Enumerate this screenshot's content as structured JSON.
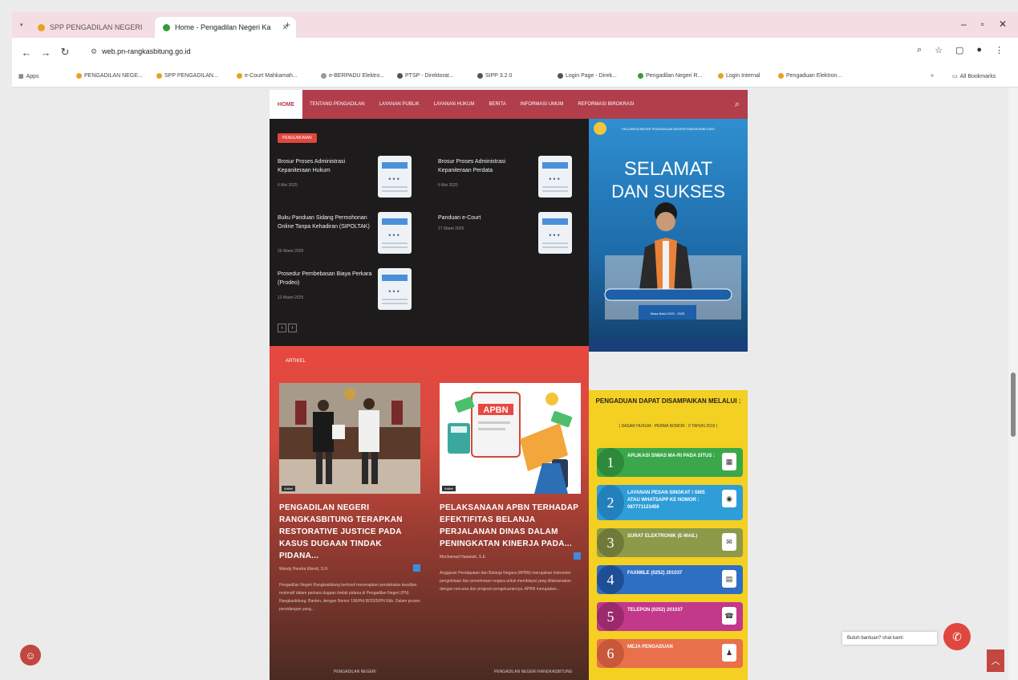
{
  "browser": {
    "tabs": [
      {
        "label": "SPP PENGADILAN NEGERI",
        "active": false
      },
      {
        "label": "Home - Pengadilan Negeri Ka",
        "active": true
      }
    ],
    "url": "web.pn-rangkasbitung.go.id",
    "bookmarks": [
      "Apps",
      "PENGADILAN NEGE...",
      "SPP PENGADILAN...",
      "e-Court Mahkamah...",
      "e-BERPADU Elektro...",
      "PTSP - Direktorat...",
      "SIPP 3.2.0",
      "Login Page - Direk...",
      "Pengadilan Negeri R...",
      "Login Internal",
      "Pengaduan Elektron..."
    ],
    "all_bookmarks": "All Bookmarks"
  },
  "nav": {
    "home": "HOME",
    "items": [
      "TENTANG PENGADILAN",
      "LAYANAN PUBLIK",
      "LAYANAN HUKUM",
      "BERITA",
      "INFORMASI UMUM",
      "REFORMASI BIROKRASI"
    ]
  },
  "announcements": {
    "badge": "PENGUMUMAN",
    "posts": [
      {
        "title": "Brosur Proses Administrasi Kepaniteraan Hukum",
        "date": "6 Mei 2025"
      },
      {
        "title": "Brosur Proses Administrasi Kepaniteraan Perdata",
        "date": "6 Mei 2025"
      },
      {
        "title": "Buku Panduan Sidang Permohonan Online Tanpa Kehadiran (SIPOLTAK)",
        "date": "26 Maret 2025"
      },
      {
        "title": "Panduan e-Court",
        "date": "17 Maret 2025"
      },
      {
        "title": "Prosedur Pembebasan Biaya Perkara (Prodeo)",
        "date": "13 Maret 2025"
      }
    ]
  },
  "articles": {
    "badge": "ARTIKEL",
    "cards": [
      {
        "img_label": "Artikel",
        "title": "PENGADILAN NEGERI RANGKASBITUNG TERAPKAN RESTORATIVE JUSTICE PADA KASUS DUGAAN TINDAK PIDANA...",
        "meta": "Wendy Hendra Efendi, S.H.",
        "excerpt": "Pengadilan Negeri Rangkasbitung berhasil menerapkan pendekatan keadilan restoratif dalam perkara dugaan tindak pidana di Pengadilan Negeri (PN) Rangkasbitung. Banten, dengan Nomor 196/Pid.B/2025/PN Rkb. Dalam proses persidangan yang..."
      },
      {
        "img_label": "Artikel",
        "title": "PELAKSANAAN APBN TERHADAP EFEKTIFITAS BELANJA PERJALANAN DINAS DALAM PENINGKATAN KINERJA PADA...",
        "meta": "Mochamad Hasanah, S.E.",
        "excerpt": "Anggaran Pendapatan dan Belanja Negara (APBN) merupakan instrumen pengelolaan dan penerimaan negara untuk membiayai yang dilaksanakan dengan rencana dan program pengeluarannya. APBN merupakan..."
      }
    ],
    "bottom": [
      "PENGADILAN NEGERI",
      "PENGADILAN NEGERI RANGKASBITUNG"
    ]
  },
  "banner": {
    "line1": "SELAMAT",
    "line2": "DAN SUKSES",
    "small": "KELUARGA BESAR PENGADILAN NEGERI RANGKASBITUNG",
    "period": "Masa Bakti 2025 - 2028"
  },
  "complaint": {
    "title": "PENGADUAN DAPAT DISAMPAIKAN MELALUI :",
    "sub": "( DASAR HUKUM : PERMA NOMOR : 9 TAHUN 2016 )",
    "rows": [
      {
        "num": "1",
        "text": "APLIKASI SIWAS MA-RI PADA SITUS :",
        "color": "#3aa84a",
        "icon": "▦"
      },
      {
        "num": "2",
        "text": "LAYANAN PESAN SINGKAT / SMS ATAU WHATSAPP KE NOMOR : 087771123456",
        "color": "#2f9ed8",
        "icon": "◉"
      },
      {
        "num": "3",
        "text": "SURAT ELEKTRONIK (E-MAIL)",
        "color": "#8c9a4a",
        "icon": "✉"
      },
      {
        "num": "4",
        "text": "FAXIMILE (0252) 201037",
        "color": "#2f6fc2",
        "icon": "▤"
      },
      {
        "num": "5",
        "text": "TELEPON (0252) 201037",
        "color": "#c2388a",
        "icon": "☎"
      },
      {
        "num": "6",
        "text": "MEJA PENGADUAN",
        "color": "#e8704a",
        "icon": "♟"
      }
    ]
  },
  "chat": {
    "label": "Butuh bantuan? chat kami"
  }
}
